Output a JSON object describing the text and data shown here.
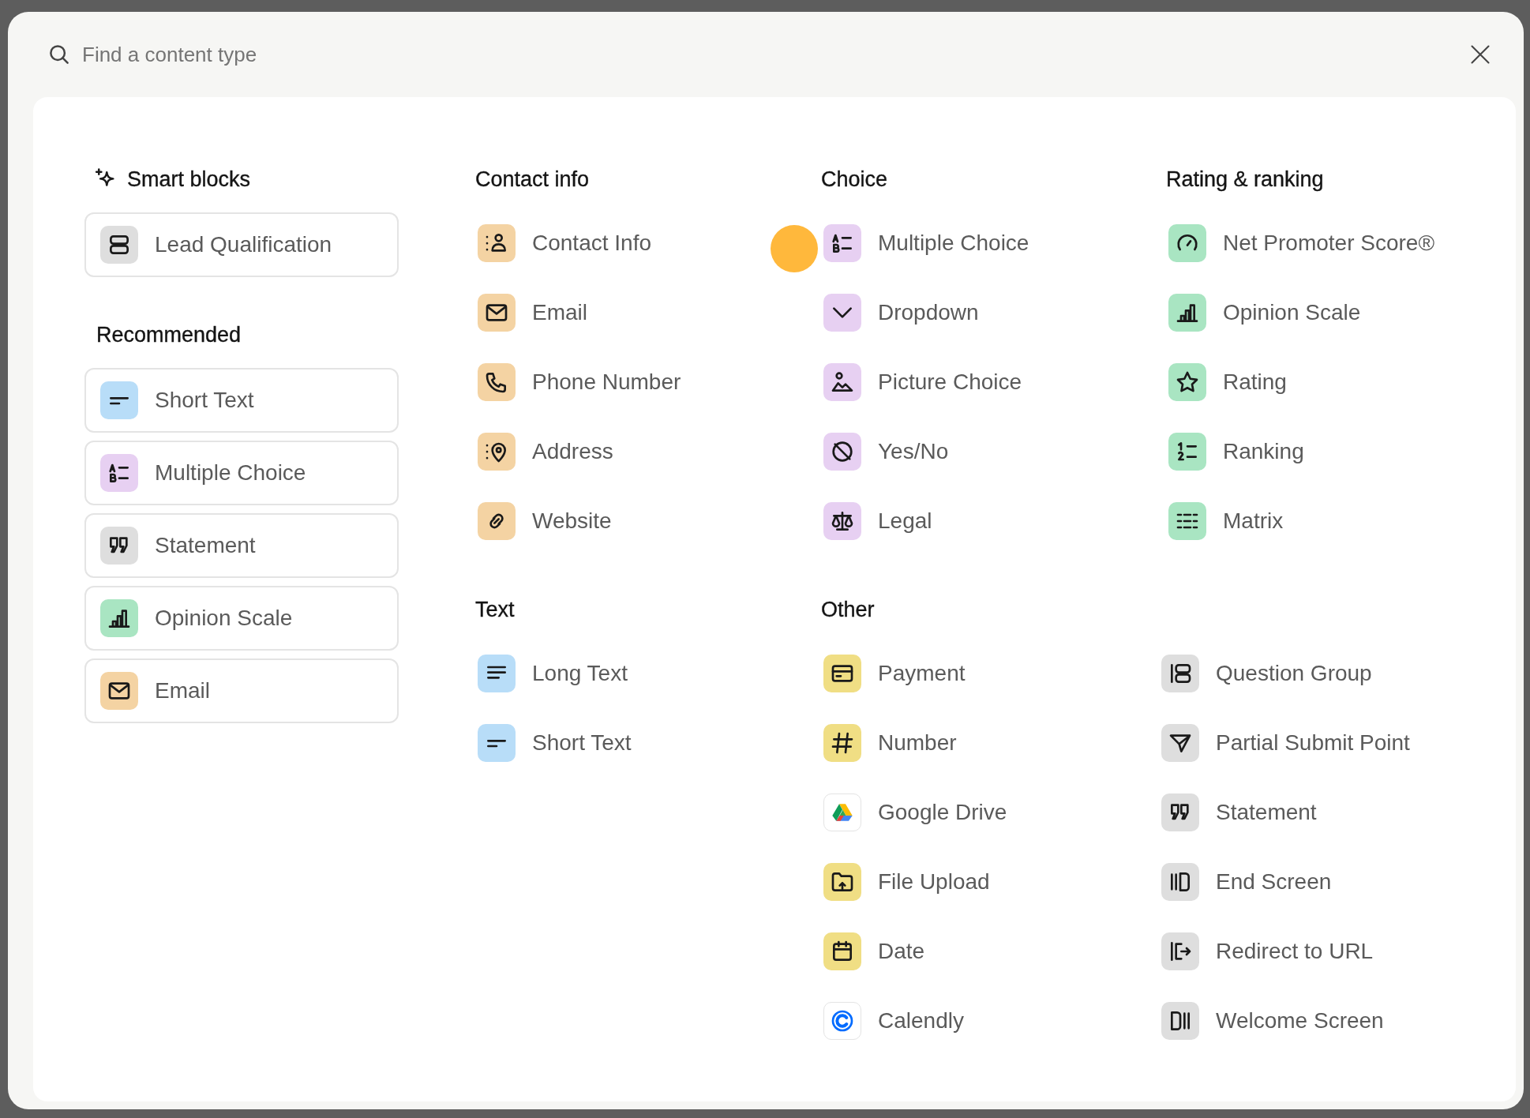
{
  "search": {
    "placeholder": "Find a content type"
  },
  "sections": [
    {
      "title": "Smart blocks",
      "featured": true,
      "kind": "cards",
      "items": [
        {
          "label": "Lead Qualification",
          "kind": "stack",
          "color": "#dedede"
        }
      ]
    },
    {
      "title": "Recommended",
      "featured": false,
      "kind": "cards",
      "items": [
        {
          "label": "Short Text",
          "kind": "short-text",
          "color": "#b8ddf8"
        },
        {
          "label": "Multiple Choice",
          "kind": "choice-list",
          "color": "#e7d0f2"
        },
        {
          "label": "Statement",
          "kind": "quote",
          "color": "#dedede"
        },
        {
          "label": "Opinion Scale",
          "kind": "bars",
          "color": "#a9e5c2"
        },
        {
          "label": "Email",
          "kind": "envelope",
          "color": "#f4d3a3"
        }
      ]
    },
    {
      "title": "Contact info",
      "featured": false,
      "kind": "list",
      "items": [
        {
          "label": "Contact Info",
          "kind": "person",
          "color": "#f4d3a3"
        },
        {
          "label": "Email",
          "kind": "envelope",
          "color": "#f4d3a3"
        },
        {
          "label": "Phone Number",
          "kind": "phone",
          "color": "#f4d3a3"
        },
        {
          "label": "Address",
          "kind": "pin",
          "color": "#f4d3a3"
        },
        {
          "label": "Website",
          "kind": "link",
          "color": "#f4d3a3"
        }
      ]
    },
    {
      "title": "Text",
      "featured": false,
      "kind": "list",
      "items": [
        {
          "label": "Long Text",
          "kind": "long-text",
          "color": "#b8ddf8"
        },
        {
          "label": "Short Text",
          "kind": "short-text",
          "color": "#b8ddf8"
        }
      ]
    },
    {
      "title": "Choice",
      "featured": false,
      "kind": "list",
      "items": [
        {
          "label": "Multiple Choice",
          "kind": "choice-list",
          "color": "#e7d0f2"
        },
        {
          "label": "Dropdown",
          "kind": "chevron",
          "color": "#e7d0f2"
        },
        {
          "label": "Picture Choice",
          "kind": "picture",
          "color": "#e7d0f2"
        },
        {
          "label": "Yes/No",
          "kind": "slashed-circle",
          "color": "#e7d0f2"
        },
        {
          "label": "Legal",
          "kind": "scales",
          "color": "#e7d0f2"
        }
      ]
    },
    {
      "title": "Rating & ranking",
      "featured": false,
      "kind": "list",
      "items": [
        {
          "label": "Net Promoter Score®",
          "kind": "gauge",
          "color": "#a9e5c2"
        },
        {
          "label": "Opinion Scale",
          "kind": "bars",
          "color": "#a9e5c2"
        },
        {
          "label": "Rating",
          "kind": "star",
          "color": "#a9e5c2"
        },
        {
          "label": "Ranking",
          "kind": "ranked-list",
          "color": "#a9e5c2"
        },
        {
          "label": "Matrix",
          "kind": "grid",
          "color": "#a9e5c2"
        }
      ]
    },
    {
      "title": "Other",
      "featured": false,
      "kind": "two-column",
      "items": [
        {
          "label": "Payment",
          "kind": "card",
          "color": "#f0de84"
        },
        {
          "label": "Number",
          "kind": "hash",
          "color": "#f0de84"
        },
        {
          "label": "Google Drive",
          "kind": "drive",
          "color": "#ffffff"
        },
        {
          "label": "File Upload",
          "kind": "folder",
          "color": "#f0de84"
        },
        {
          "label": "Date",
          "kind": "calendar",
          "color": "#f0de84"
        },
        {
          "label": "Calendly",
          "kind": "c-ring",
          "color": "#ffffff"
        },
        {
          "label": "Question Group",
          "kind": "group",
          "color": "#dedede"
        },
        {
          "label": "Partial Submit Point",
          "kind": "plane",
          "color": "#dedede"
        },
        {
          "label": "Statement",
          "kind": "quote",
          "color": "#dedede"
        },
        {
          "label": "End Screen",
          "kind": "end-screen",
          "color": "#dedede"
        },
        {
          "label": "Redirect to URL",
          "kind": "redirect",
          "color": "#dedede"
        },
        {
          "label": "Welcome Screen",
          "kind": "welcome-screen",
          "color": "#dedede"
        }
      ]
    }
  ]
}
